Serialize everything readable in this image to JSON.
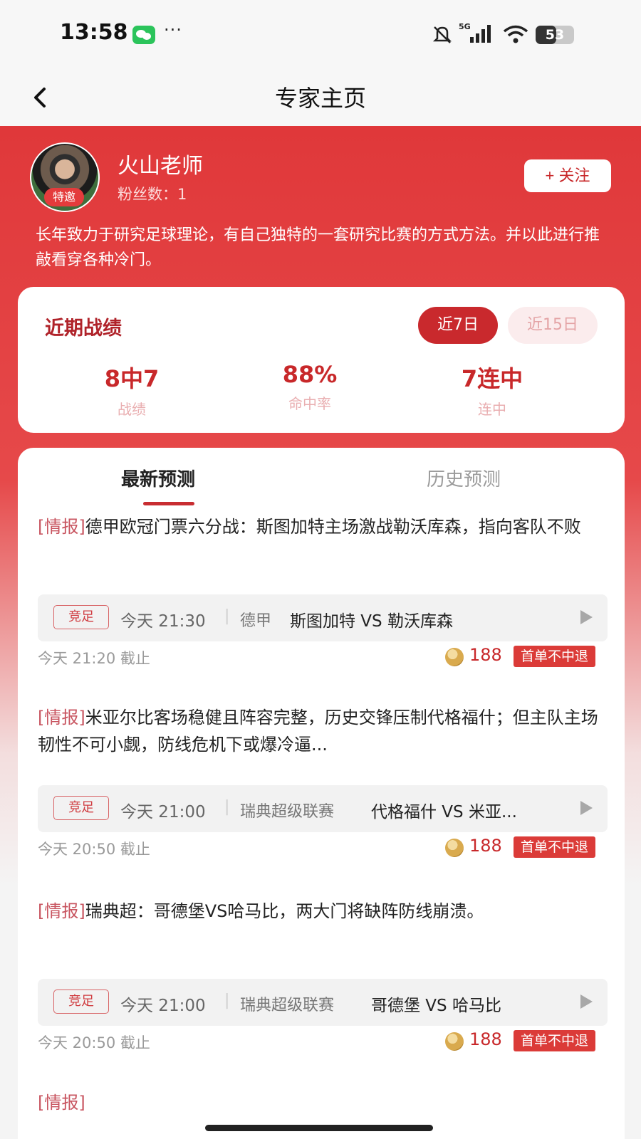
{
  "status_bar": {
    "time": "13:58",
    "more": "···",
    "network": "5G",
    "battery_level": 53,
    "battery_text": "53",
    "icons": [
      "wechat-icon",
      "mute-icon",
      "signal-icon",
      "wifi-icon",
      "battery-icon"
    ]
  },
  "nav": {
    "title": "专家主页",
    "back_icon": "chevron-left-icon"
  },
  "expert": {
    "name": "火山老师",
    "badge": "特邀",
    "fans": "粉丝数：1",
    "follow_label": "+ 关注",
    "bio": "长年致力于研究足球理论，有自己独特的一套研究比赛的方式方法。并以此进行推敲看穿各种冷门。"
  },
  "record": {
    "title": "近期战绩",
    "periods": [
      "近7日",
      "近15日"
    ],
    "selected_period": "近7日",
    "stats": [
      {
        "value": "8中7",
        "label": "战绩"
      },
      {
        "value": "88%",
        "label": "命中率"
      },
      {
        "value": "7连中",
        "label": "连中"
      }
    ]
  },
  "tabs": {
    "latest": "最新预测",
    "history": "历史预测",
    "selected": "最新预测"
  },
  "predictions": [
    {
      "tag": "[情报]",
      "headline": "德甲欧冠门票六分战：斯图加特主场激战勒沃库森，指向客队不败",
      "badge": "竞足",
      "time": "今天 21:30",
      "league": "德甲",
      "teams": "斯图加特 VS 勒沃库森",
      "deadline": "今天 21:20 截止",
      "price": "188",
      "refund": "首单不中退"
    },
    {
      "tag": "[情报]",
      "headline": "米亚尔比客场稳健且阵容完整，历史交锋压制代格福什；但主队主场韧性不可小觑，防线危机下或爆冷逼...",
      "badge": "竞足",
      "time": "今天 21:00",
      "league": "瑞典超级联赛",
      "teams": "代格福什 VS 米亚...",
      "deadline": "今天 20:50 截止",
      "price": "188",
      "refund": "首单不中退"
    },
    {
      "tag": "[情报]",
      "headline": "瑞典超：哥德堡VS哈马比，两大门将缺阵防线崩溃。",
      "badge": "竞足",
      "time": "今天 21:00",
      "league": "瑞典超级联赛",
      "teams": "哥德堡 VS 哈马比",
      "deadline": "今天 20:50 截止",
      "price": "188",
      "refund": "首单不中退"
    }
  ],
  "partial_next": "[情报]",
  "colors": {
    "brand_red": "#e0383a",
    "accent_red": "#c8282a",
    "tag_red": "#c85560"
  }
}
